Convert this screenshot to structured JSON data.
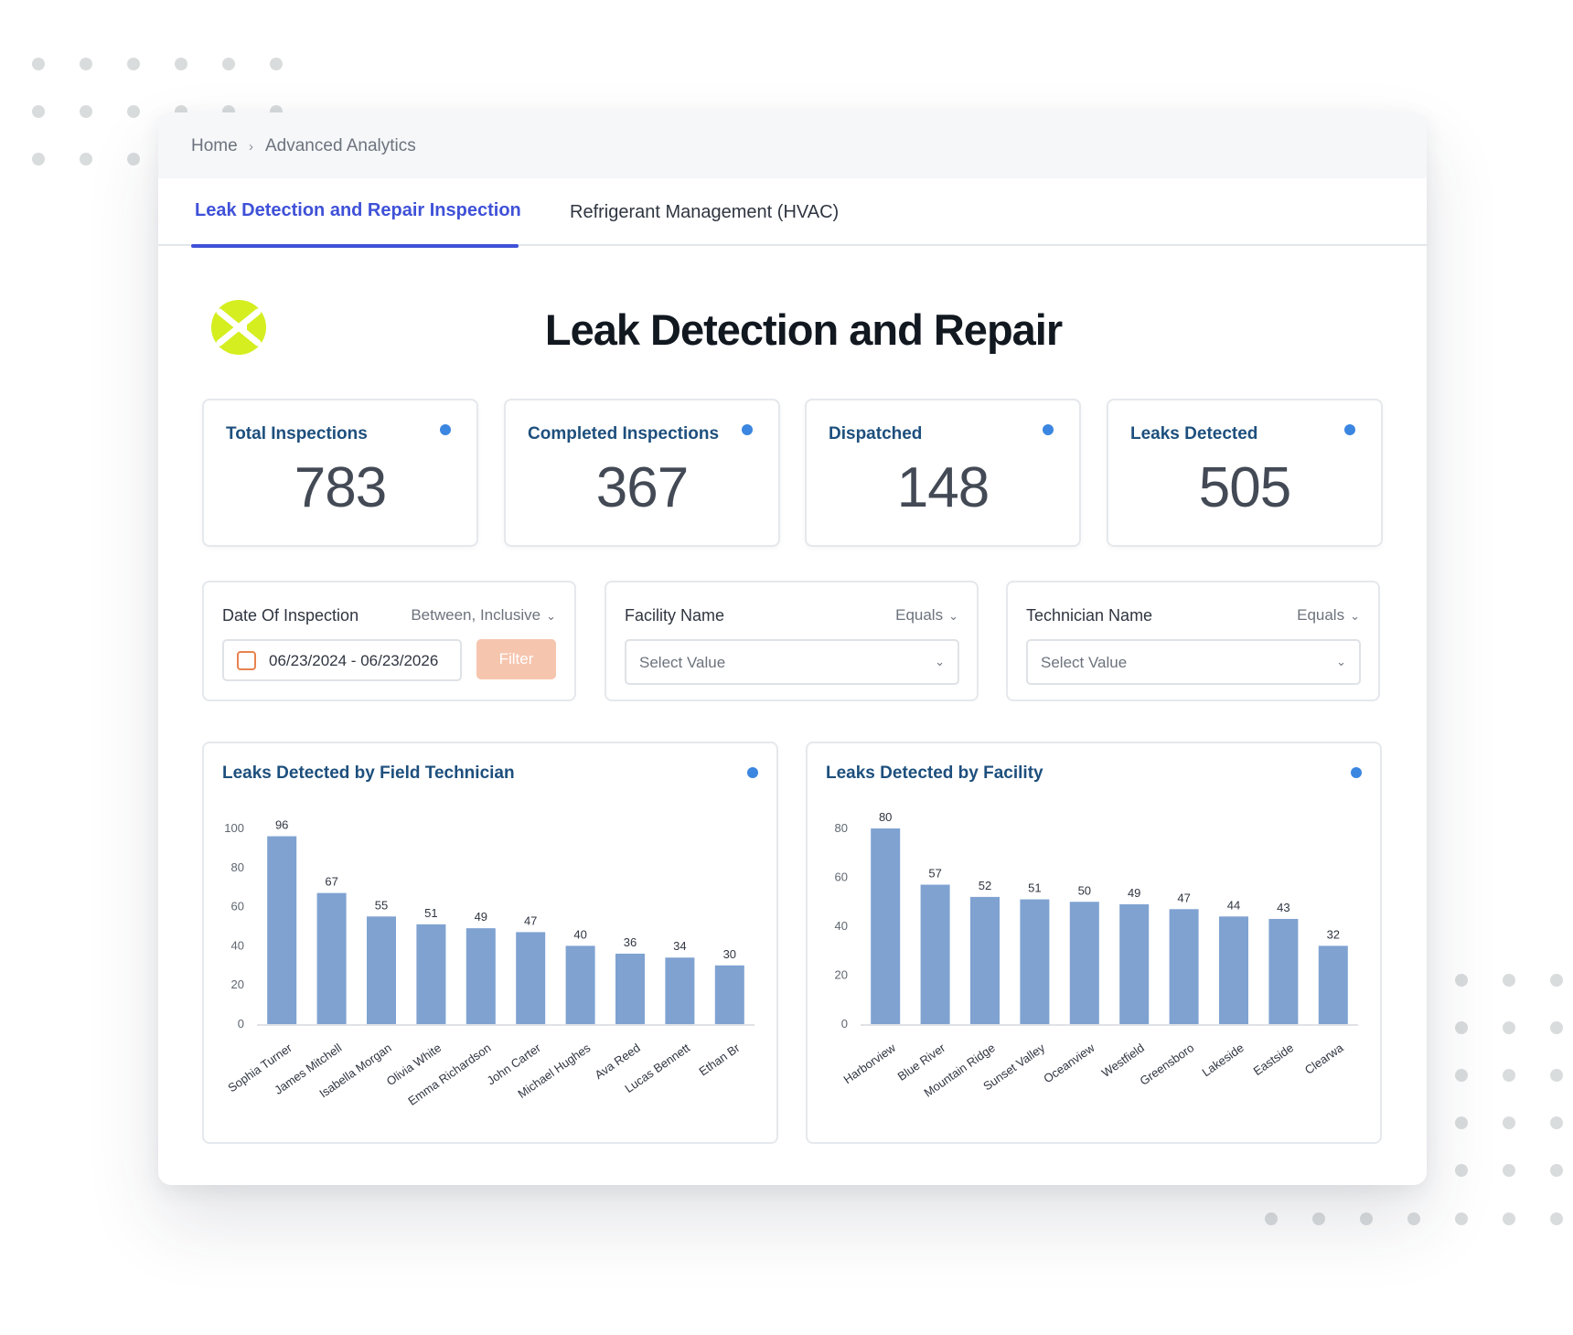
{
  "breadcrumb": {
    "home": "Home",
    "current": "Advanced Analytics"
  },
  "tabs": [
    {
      "label": "Leak Detection and Repair Inspection",
      "active": true
    },
    {
      "label": "Refrigerant Management (HVAC)",
      "active": false
    }
  ],
  "page": {
    "title": "Leak Detection and Repair"
  },
  "kpis": [
    {
      "label": "Total Inspections",
      "value": "783"
    },
    {
      "label": "Completed Inspections",
      "value": "367"
    },
    {
      "label": "Dispatched",
      "value": "148"
    },
    {
      "label": "Leaks Detected",
      "value": "505"
    }
  ],
  "filters": {
    "date": {
      "label": "Date Of Inspection",
      "operator": "Between, Inclusive",
      "value": "06/23/2024 - 06/23/2026",
      "button": "Filter"
    },
    "facility": {
      "label": "Facility Name",
      "operator": "Equals",
      "placeholder": "Select Value"
    },
    "technician": {
      "label": "Technician Name",
      "operator": "Equals",
      "placeholder": "Select Value"
    }
  },
  "colors": {
    "accent": "#3f51d8",
    "bar": "#7fa2d1",
    "kpi_label": "#1d4f7d",
    "indicator": "#3b86e0",
    "filter_button": "#f6c5ae",
    "logo": "#d4ee1f"
  },
  "icons": [
    "logo-icon",
    "info-dot-icon",
    "calendar-icon",
    "chevron-down-icon"
  ],
  "chart_data": [
    {
      "type": "bar",
      "title": "Leaks Detected by Field Technician",
      "categories": [
        "Sophia Turner",
        "James Mitchell",
        "Isabella Morgan",
        "Olivia White",
        "Emma Richardson",
        "John Carter",
        "Michael Hughes",
        "Ava Reed",
        "Lucas Bennett",
        "Ethan Br"
      ],
      "values": [
        96,
        67,
        55,
        51,
        49,
        47,
        40,
        36,
        34,
        30
      ],
      "ylim": [
        0,
        100
      ],
      "yticks": [
        0,
        20,
        40,
        60,
        80,
        100
      ],
      "grid": false,
      "legend": "none"
    },
    {
      "type": "bar",
      "title": "Leaks Detected by Facility",
      "categories": [
        "Harborview",
        "Blue River",
        "Mountain Ridge",
        "Sunset Valley",
        "Oceanview",
        "Westfield",
        "Greensboro",
        "Lakeside",
        "Eastside",
        "Clearwa"
      ],
      "values": [
        80,
        57,
        52,
        51,
        50,
        49,
        47,
        44,
        43,
        32
      ],
      "ylim": [
        0,
        80
      ],
      "yticks": [
        0,
        20,
        40,
        60,
        80
      ],
      "grid": false,
      "legend": "none"
    }
  ]
}
